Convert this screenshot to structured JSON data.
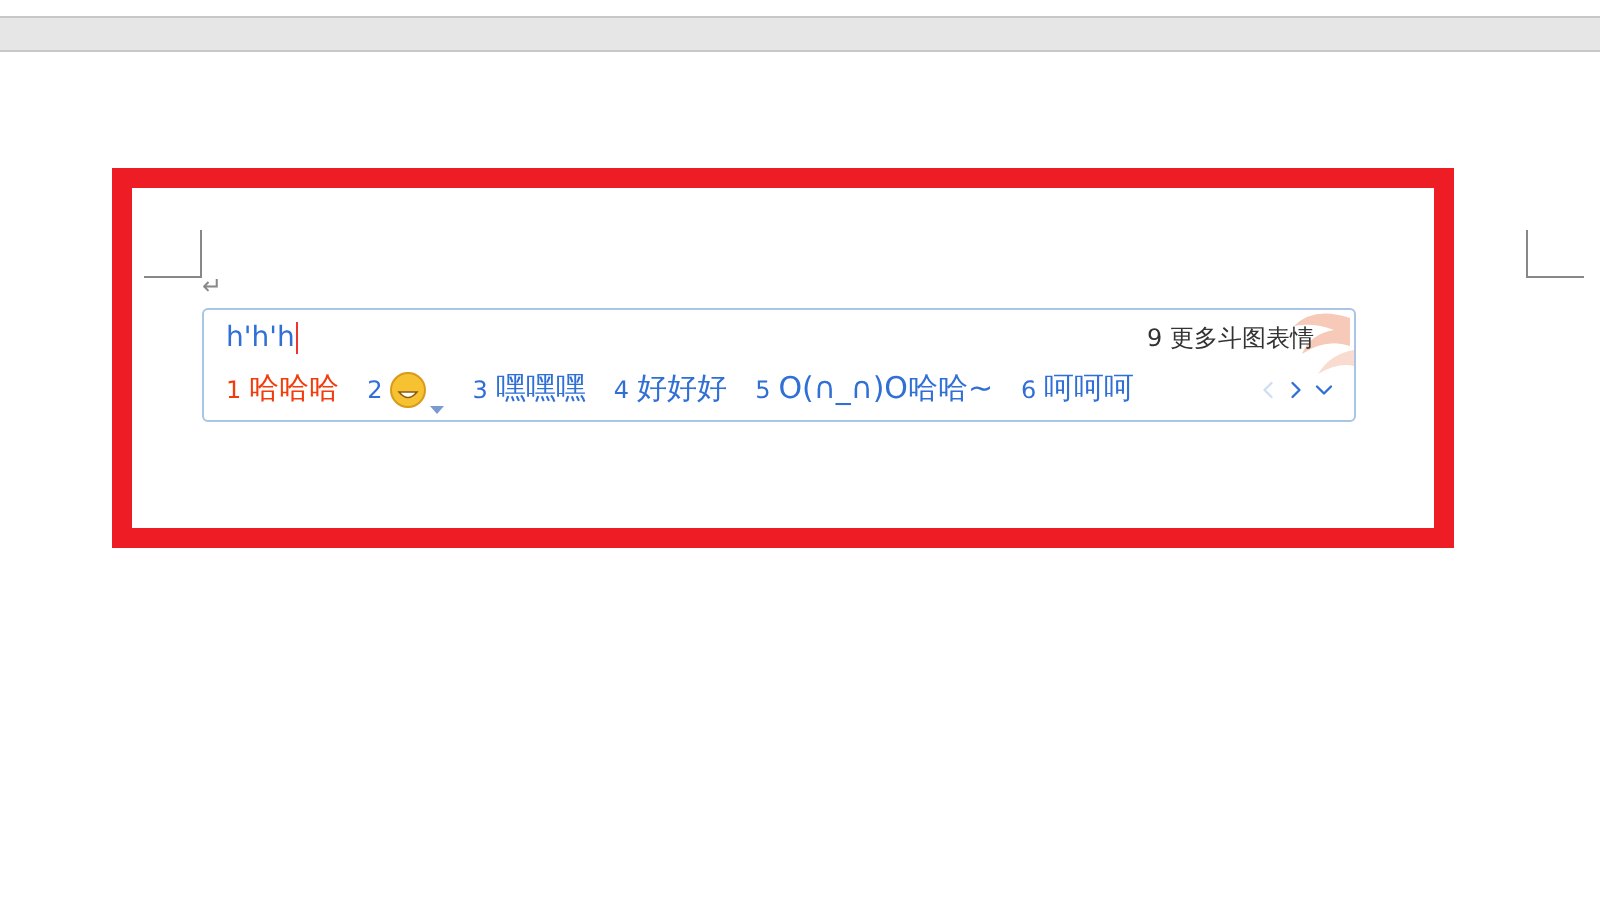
{
  "input": {
    "text": "h'h'h"
  },
  "more_link": {
    "number": "9",
    "label": "更多斗图表情"
  },
  "candidates": [
    {
      "kind": "text",
      "number": "1",
      "text": "哈哈哈",
      "selected": true
    },
    {
      "kind": "emoji",
      "number": "2",
      "selected": false
    },
    {
      "kind": "text",
      "number": "3",
      "text": "嘿嘿嘿",
      "selected": false
    },
    {
      "kind": "text",
      "number": "4",
      "text": "好好好",
      "selected": false
    },
    {
      "kind": "text",
      "number": "5",
      "text": "O(∩_∩)O哈哈~",
      "selected": false
    },
    {
      "kind": "text",
      "number": "6",
      "text": "呵呵呵",
      "selected": false
    }
  ],
  "paging": {
    "previous_disabled": true,
    "next_disabled": false
  },
  "paragraph_mark": "↵"
}
